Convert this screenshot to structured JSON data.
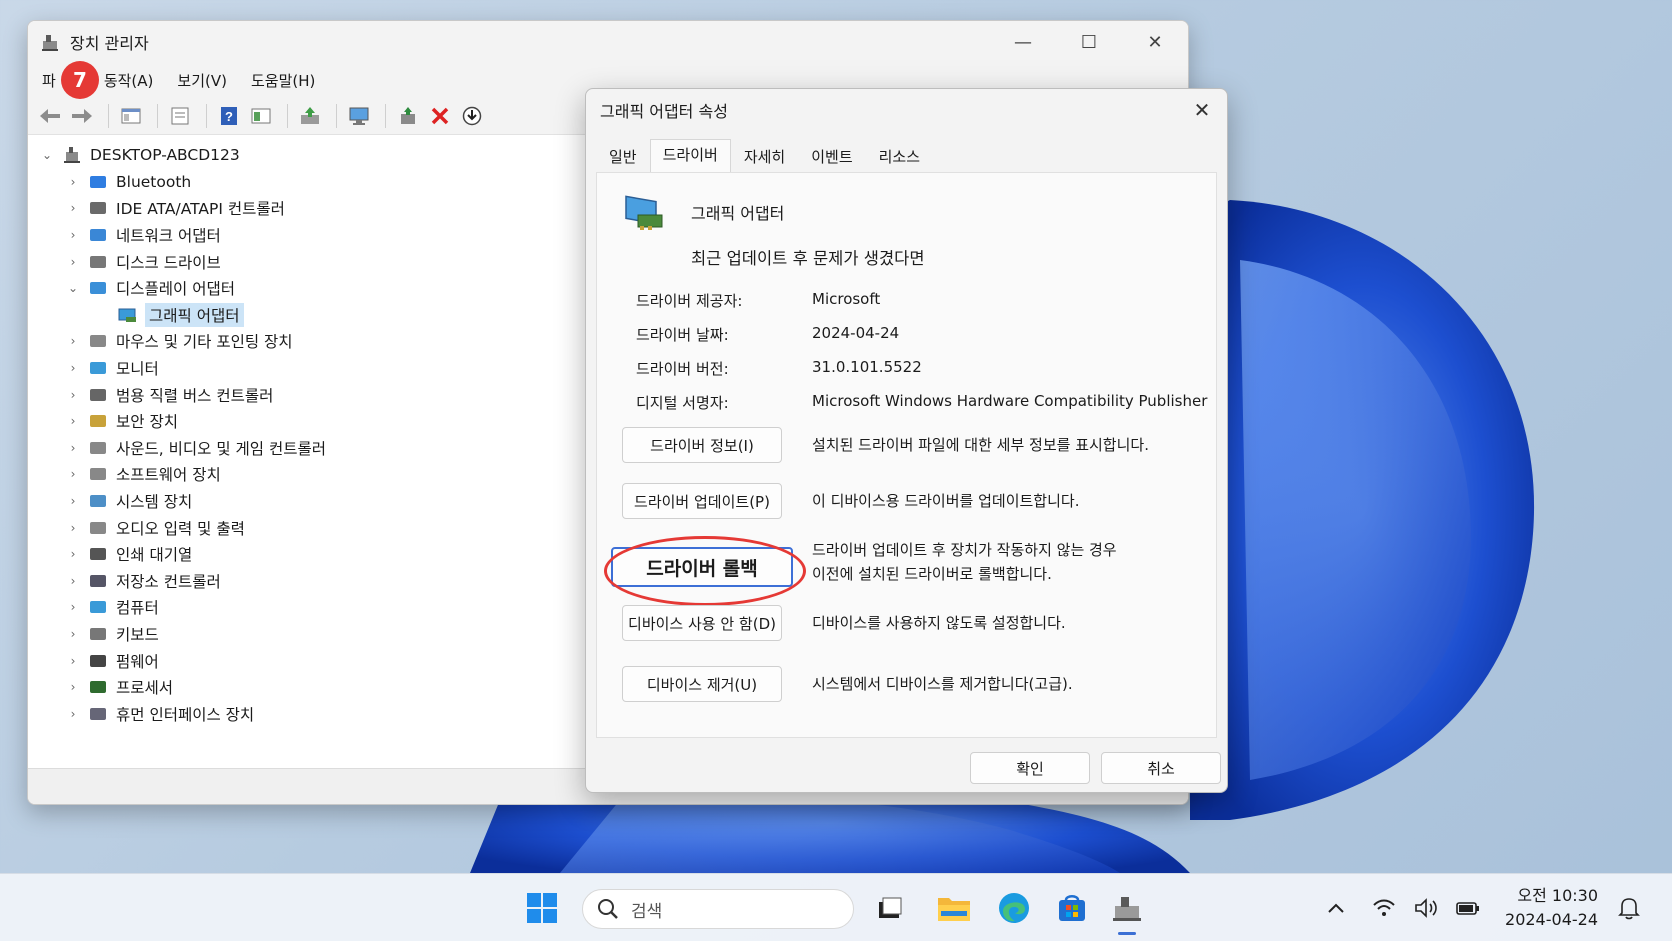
{
  "window": {
    "title": "장치 관리자",
    "controls": {
      "minimize": "—",
      "maximize": "☐",
      "close": "✕"
    }
  },
  "menu": {
    "file": "파",
    "action": "동작(A)",
    "view": "보기(V)",
    "help": "도움말(H)"
  },
  "step_badge": "7",
  "tree": {
    "root": "DESKTOP-ABCD123",
    "items": [
      {
        "label": "Bluetooth",
        "icon": "bluetooth-icon"
      },
      {
        "label": "IDE ATA/ATAPI 컨트롤러",
        "icon": "ide-controller-icon"
      },
      {
        "label": "네트워크 어댑터",
        "icon": "network-adapter-icon"
      },
      {
        "label": "디스크 드라이브",
        "icon": "disk-drive-icon"
      },
      {
        "label": "디스플레이 어댑터",
        "icon": "display-adapter-icon",
        "expanded": true
      },
      {
        "label": "마우스 및 기타 포인팅 장치",
        "icon": "mouse-icon"
      },
      {
        "label": "모니터",
        "icon": "monitor-icon"
      },
      {
        "label": "범용 직렬 버스 컨트롤러",
        "icon": "usb-icon"
      },
      {
        "label": "보안 장치",
        "icon": "security-device-icon"
      },
      {
        "label": "사운드, 비디오 및 게임 컨트롤러",
        "icon": "sound-icon"
      },
      {
        "label": "소프트웨어 장치",
        "icon": "software-device-icon"
      },
      {
        "label": "시스템 장치",
        "icon": "system-device-icon"
      },
      {
        "label": "오디오 입력 및 출력",
        "icon": "audio-io-icon"
      },
      {
        "label": "인쇄 대기열",
        "icon": "print-queue-icon"
      },
      {
        "label": "저장소 컨트롤러",
        "icon": "storage-controller-icon"
      },
      {
        "label": "컴퓨터",
        "icon": "computer-icon"
      },
      {
        "label": "키보드",
        "icon": "keyboard-icon"
      },
      {
        "label": "펌웨어",
        "icon": "firmware-icon"
      },
      {
        "label": "프로세서",
        "icon": "processor-icon"
      },
      {
        "label": "휴먼 인터페이스 장치",
        "icon": "hid-icon"
      }
    ],
    "child_selected": "그래픽 어댑터"
  },
  "dialog": {
    "title": "그래픽 어댑터 속성",
    "close": "✕",
    "tabs": [
      "일반",
      "드라이버",
      "자세히",
      "이벤트",
      "리소스"
    ],
    "active_tab": "드라이버",
    "device_name": "그래픽 어댑터",
    "note": "최근 업데이트 후 문제가 생겼다면",
    "info": {
      "provider_label": "드라이버 제공자:",
      "provider": "Microsoft",
      "date_label": "드라이버 날짜:",
      "date": "2024-04-24",
      "version_label": "드라이버 버전:",
      "version": "31.0.101.5522",
      "signer_label": "디지털 서명자:",
      "signer": "Microsoft Windows Hardware Compatibility Publisher"
    },
    "actions": {
      "details_btn": "드라이버 정보(I)",
      "details_desc": "설치된 드라이버 파일에 대한 세부 정보를 표시합니다.",
      "update_btn": "드라이버 업데이트(P)",
      "update_desc": "이 디바이스용 드라이버를 업데이트합니다.",
      "rollback_btn": "드라이버 롤백",
      "rollback_desc_1": "드라이버 업데이트 후 장치가 작동하지 않는 경우",
      "rollback_desc_2": "이전에 설치된 드라이버로 롤백합니다.",
      "disable_btn": "디바이스 사용 안 함(D)",
      "disable_desc": "디바이스를 사용하지 않도록 설정합니다.",
      "uninstall_btn": "디바이스 제거(U)",
      "uninstall_desc": "시스템에서 디바이스를 제거합니다(고급)."
    },
    "ok": "확인",
    "cancel": "취소"
  },
  "taskbar": {
    "search_placeholder": "검색",
    "time": "오전 10:30",
    "date": "2024-04-24"
  },
  "colors": {
    "accent": "#3b6fd4",
    "highlight": "#e53935"
  }
}
